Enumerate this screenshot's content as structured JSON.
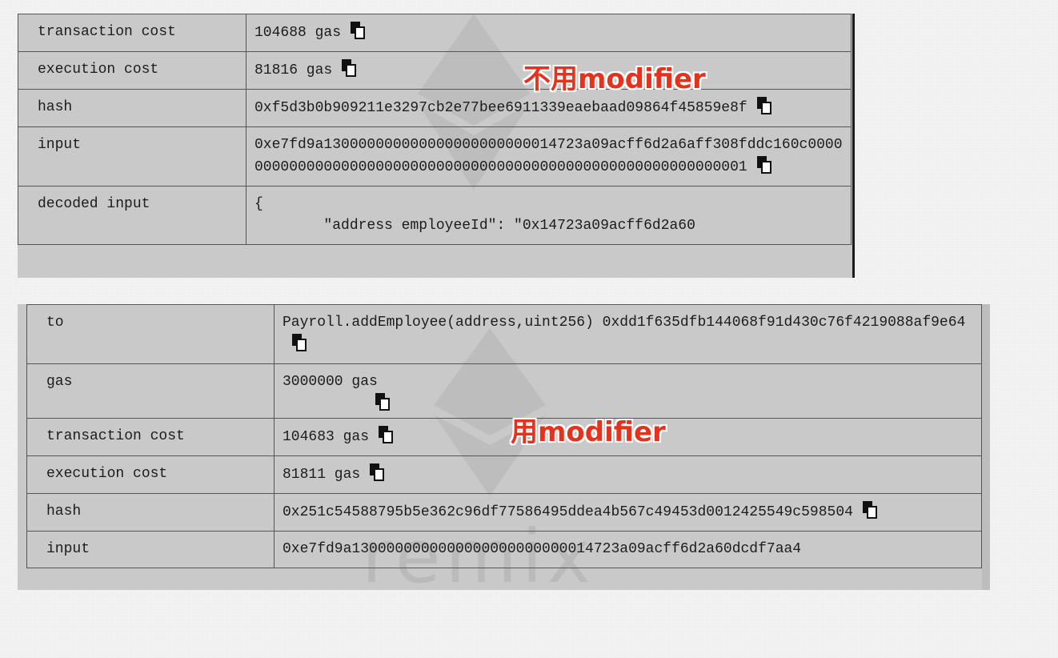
{
  "top_panel": {
    "annotation": "不用modifier",
    "rows": [
      {
        "key": "transaction cost",
        "value": "104688 gas"
      },
      {
        "key": "execution cost",
        "value": "81816 gas"
      },
      {
        "key": "hash",
        "value": "0xf5d3b0b909211e3297cb2e77bee6911339eaebaad09864f45859e8f"
      },
      {
        "key": "input",
        "value": "0xe7fd9a130000000000000000000000014723a09acff6d2a6aff308fddc160c0000000000000000000000000000000000000000000000000000000000001"
      },
      {
        "key": "decoded input",
        "value": "{\n\t\"address employeeId\": \"0x14723a09acff6d2a60"
      }
    ]
  },
  "bottom_panel": {
    "annotation": "用modifier",
    "rows": [
      {
        "key": "to",
        "value": "Payroll.addEmployee(address,uint256) 0xdd1f635dfb144068f91d430c76f4219088af9e64"
      },
      {
        "key": "gas",
        "value": "3000000 gas"
      },
      {
        "key": "transaction cost",
        "value": "104683 gas"
      },
      {
        "key": "execution cost",
        "value": "81811 gas"
      },
      {
        "key": "hash",
        "value": "0x251c54588795b5e362c96df77586495ddea4b567c49453d0012425549c598504"
      },
      {
        "key": "input",
        "value": "0xe7fd9a1300000000000000000000000014723a09acff6d2a60dcdf7aa4"
      }
    ]
  },
  "watermark": "remix",
  "colors": {
    "annotation": "#e5321d",
    "panel_bg": "#c9c9c9",
    "border": "#555555"
  }
}
